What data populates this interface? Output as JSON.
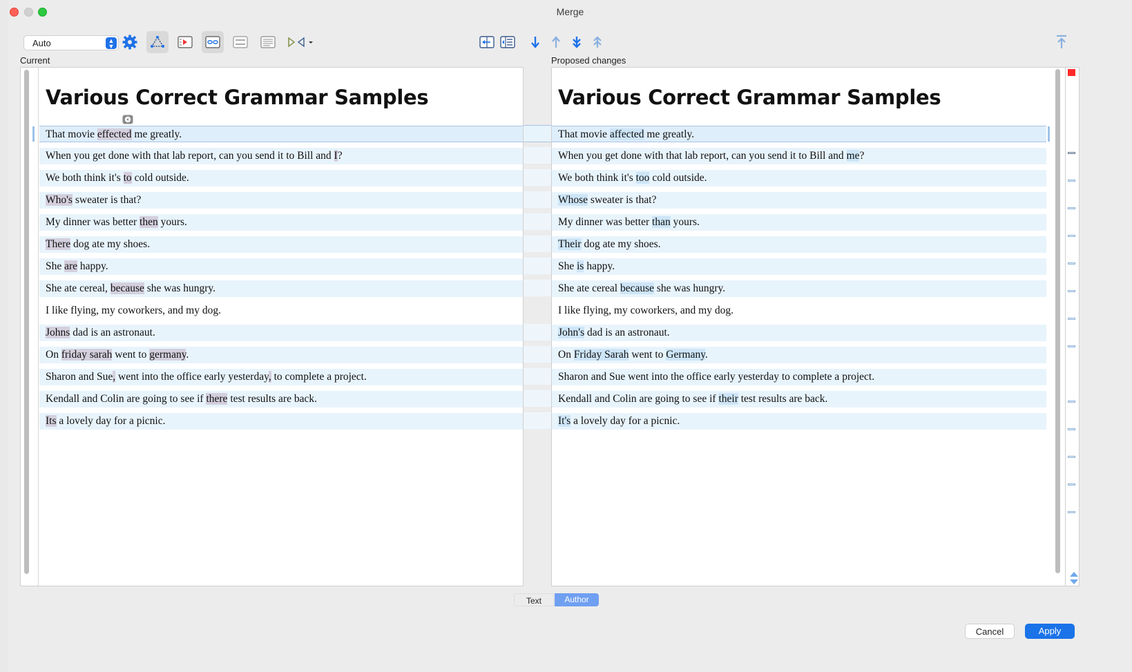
{
  "window": {
    "title": "Merge"
  },
  "toolbar": {
    "mode_select": {
      "value": "Auto",
      "icon": "chevron-updown-icon"
    },
    "left_icons": [
      "gear-icon",
      "triangle-nodes-icon",
      "play-panel-icon",
      "link-panel-icon",
      "toggle-panel-icon",
      "lines-panel-icon",
      "diff-arrows-icon"
    ],
    "center_icons": [
      "merge-left-icon",
      "merge-list-icon",
      "arrow-down-icon",
      "arrow-up-icon",
      "double-arrow-down-icon",
      "double-arrow-up-icon"
    ],
    "right_icons": [
      "arrow-top-icon"
    ]
  },
  "panes": {
    "left_label": "Current",
    "right_label": "Proposed changes",
    "doc_title": "Various Correct Grammar Samples"
  },
  "rows": [
    {
      "left": [
        [
          "That movie ",
          0
        ],
        [
          "effected",
          1
        ],
        [
          " me greatly.",
          0
        ]
      ],
      "right": [
        [
          "That movie ",
          0
        ],
        [
          "affected",
          1
        ],
        [
          " me greatly.",
          0
        ]
      ]
    },
    {
      "left": [
        [
          "When you get done with that lab report, can you send it to Bill and ",
          0
        ],
        [
          "I",
          1
        ],
        [
          "?",
          0
        ]
      ],
      "right": [
        [
          "When you get done with that lab report, can you send it to Bill and ",
          0
        ],
        [
          "me",
          1
        ],
        [
          "?",
          0
        ]
      ]
    },
    {
      "left": [
        [
          "We both think it's ",
          0
        ],
        [
          "to",
          1
        ],
        [
          " cold outside.",
          0
        ]
      ],
      "right": [
        [
          "We both think it's ",
          0
        ],
        [
          "too",
          1
        ],
        [
          " cold outside.",
          0
        ]
      ]
    },
    {
      "left": [
        [
          "Who's",
          1
        ],
        [
          " sweater is that?",
          0
        ]
      ],
      "right": [
        [
          "Whose",
          1
        ],
        [
          " sweater is that?",
          0
        ]
      ]
    },
    {
      "left": [
        [
          "My dinner was better ",
          0
        ],
        [
          "then",
          1
        ],
        [
          " yours.",
          0
        ]
      ],
      "right": [
        [
          "My dinner was better ",
          0
        ],
        [
          "than",
          1
        ],
        [
          " yours.",
          0
        ]
      ]
    },
    {
      "left": [
        [
          "There",
          1
        ],
        [
          " dog ate my shoes.",
          0
        ]
      ],
      "right": [
        [
          "Their",
          1
        ],
        [
          " dog ate my shoes.",
          0
        ]
      ]
    },
    {
      "left": [
        [
          "She ",
          0
        ],
        [
          "are",
          1
        ],
        [
          " happy.",
          0
        ]
      ],
      "right": [
        [
          "She ",
          0
        ],
        [
          "is",
          1
        ],
        [
          " happy.",
          0
        ]
      ]
    },
    {
      "left": [
        [
          "She ate cereal, ",
          0
        ],
        [
          "because",
          1
        ],
        [
          " she was hungry.",
          0
        ]
      ],
      "right": [
        [
          "She ate cereal ",
          0
        ],
        [
          "because",
          1
        ],
        [
          " she was hungry.",
          0
        ]
      ]
    },
    {
      "left": [
        [
          "I like flying, my coworkers, and my dog.",
          0
        ]
      ],
      "right": [
        [
          "I like flying, my coworkers, and my dog.",
          0
        ]
      ]
    },
    {
      "left": [
        [
          "Johns",
          1
        ],
        [
          " dad is an astronaut.",
          0
        ]
      ],
      "right": [
        [
          "John's",
          1
        ],
        [
          " dad is an astronaut.",
          0
        ]
      ]
    },
    {
      "left": [
        [
          "On ",
          0
        ],
        [
          "friday sarah",
          1
        ],
        [
          " went to ",
          0
        ],
        [
          "germany",
          1
        ],
        [
          ".",
          0
        ]
      ],
      "right": [
        [
          "On ",
          0
        ],
        [
          "Friday Sarah",
          1
        ],
        [
          " went to ",
          0
        ],
        [
          "Germany",
          1
        ],
        [
          ".",
          0
        ]
      ]
    },
    {
      "left": [
        [
          "Sharon and Sue",
          0
        ],
        [
          ",",
          1
        ],
        [
          " went into the office early yesterday",
          0
        ],
        [
          ",",
          1
        ],
        [
          " to complete a project.",
          0
        ]
      ],
      "right": [
        [
          "Sharon and Sue went into the office early yesterday to complete a project.",
          0
        ]
      ]
    },
    {
      "left": [
        [
          "Kendall and Colin are going to see if ",
          0
        ],
        [
          "there",
          1
        ],
        [
          " test results are back.",
          0
        ]
      ],
      "right": [
        [
          "Kendall and Colin are going to see if ",
          0
        ],
        [
          "their",
          1
        ],
        [
          " test results are back.",
          0
        ]
      ]
    },
    {
      "left": [
        [
          "Its",
          1
        ],
        [
          " a lovely day for a picnic.",
          0
        ]
      ],
      "right": [
        [
          "It's",
          1
        ],
        [
          " a lovely day for a picnic.",
          0
        ]
      ]
    }
  ],
  "bottom_tabs": {
    "text": "Text",
    "author": "Author"
  },
  "buttons": {
    "cancel": "Cancel",
    "apply": "Apply"
  },
  "colors": {
    "accent": "#1a73e8",
    "changed_left": "#d4cfdd",
    "changed_right": "#cde5f7",
    "row_bg": "#e8f4fc",
    "conflict_marker": "#ff2a2a"
  }
}
